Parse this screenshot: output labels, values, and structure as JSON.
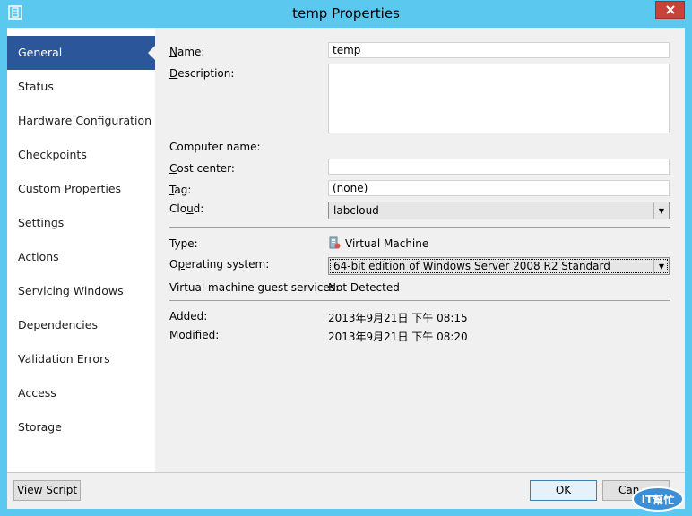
{
  "window": {
    "title": "temp Properties",
    "icon": "app-window-icon",
    "close_icon": "close-icon",
    "title_bar_color": "#5ac8ef",
    "close_color": "#c7423a"
  },
  "sidebar": {
    "active_color": "#2b579a",
    "items": [
      {
        "label": "General",
        "active": true
      },
      {
        "label": "Status"
      },
      {
        "label": "Hardware Configuration"
      },
      {
        "label": "Checkpoints"
      },
      {
        "label": "Custom Properties"
      },
      {
        "label": "Settings"
      },
      {
        "label": "Actions"
      },
      {
        "label": "Servicing Windows"
      },
      {
        "label": "Dependencies"
      },
      {
        "label": "Validation Errors"
      },
      {
        "label": "Access"
      },
      {
        "label": "Storage"
      }
    ]
  },
  "general": {
    "name_label_key": "N",
    "name_label_rest": "ame:",
    "name_value": "temp",
    "description_label_key": "D",
    "description_label_rest": "escription:",
    "description_value": "",
    "computer_name_label": "Computer name:",
    "computer_name_value": "",
    "cost_center_label_key": "C",
    "cost_center_label_rest": "ost center:",
    "cost_center_value": "",
    "tag_label_key": "T",
    "tag_label_rest": "ag:",
    "tag_value": "(none)",
    "cloud_label_pre": "Clo",
    "cloud_label_key": "u",
    "cloud_label_rest": "d:",
    "cloud_value": "labcloud",
    "type_label": "Type:",
    "type_value": "Virtual Machine",
    "type_icon": "virtual-machine-icon",
    "os_label_pre": "O",
    "os_label_key": "p",
    "os_label_rest": "erating system:",
    "os_value": "64-bit edition of Windows Server 2008 R2 Standard",
    "guest_services_label": "Virtual machine guest services:",
    "guest_services_value": "Not Detected",
    "added_label": "Added:",
    "added_value": "2013年9月21日 下午 08:15",
    "modified_label": "Modified:",
    "modified_value": "2013年9月21日 下午 08:20"
  },
  "footer": {
    "view_script_key": "V",
    "view_script_rest": "iew Script",
    "ok_label": "OK",
    "cancel_label": "Can"
  },
  "watermark": {
    "text": "IT幫忙",
    "color": "#3b8fd9"
  }
}
